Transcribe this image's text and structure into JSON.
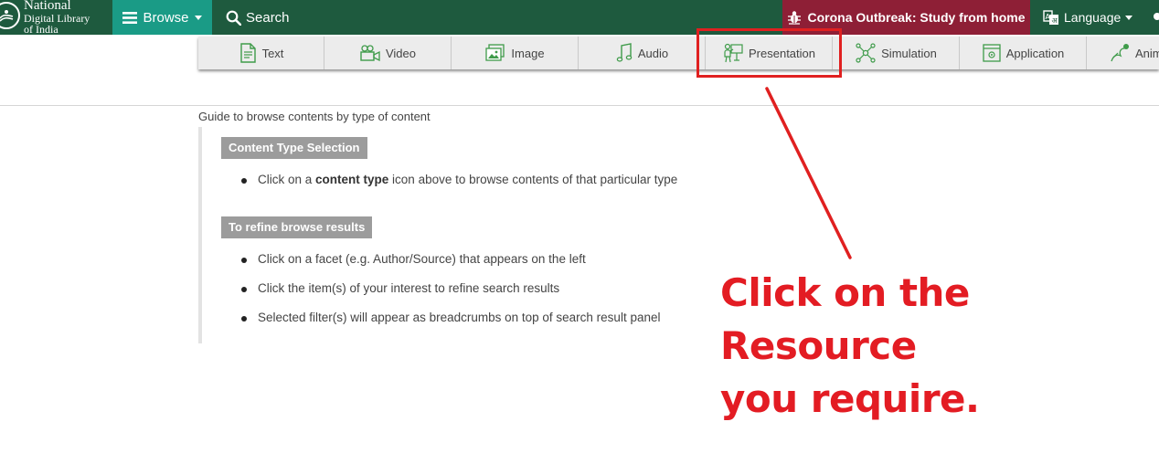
{
  "header": {
    "logo": {
      "line1": "National",
      "line2": "Digital Library",
      "line3": "of India"
    },
    "browse_label": "Browse",
    "search_label": "Search",
    "corona_label": "Corona Outbreak: Study from home",
    "language_label": "Language"
  },
  "content_types": [
    {
      "label": "Text",
      "icon": "document-icon"
    },
    {
      "label": "Video",
      "icon": "video-camera-icon"
    },
    {
      "label": "Image",
      "icon": "image-icon"
    },
    {
      "label": "Audio",
      "icon": "music-note-icon"
    },
    {
      "label": "Presentation",
      "icon": "presentation-icon"
    },
    {
      "label": "Simulation",
      "icon": "network-icon"
    },
    {
      "label": "Application",
      "icon": "application-icon"
    },
    {
      "label": "Anim",
      "icon": "animation-icon"
    }
  ],
  "guide": {
    "title": "Guide to browse contents by type of content",
    "section1": {
      "heading": "Content Type Selection",
      "bullet_pre": "Click on a ",
      "bullet_bold": "content type",
      "bullet_post": " icon above to browse contents of that particular type"
    },
    "section2": {
      "heading": "To refine browse results",
      "bullets": [
        "Click on a facet (e.g. Author/Source) that appears on the left",
        "Click the item(s) of your interest to refine search results",
        "Selected filter(s) will appear as breadcrumbs on top of search result panel"
      ]
    }
  },
  "annotation": {
    "line1": "Click on the Resource",
    "line2": "you require."
  },
  "colors": {
    "topbar": "#1e5a3e",
    "browse": "#1a9b86",
    "corona": "#8e1f36",
    "icon_green": "#3f9b4a",
    "annotation_red": "#e31c23"
  }
}
